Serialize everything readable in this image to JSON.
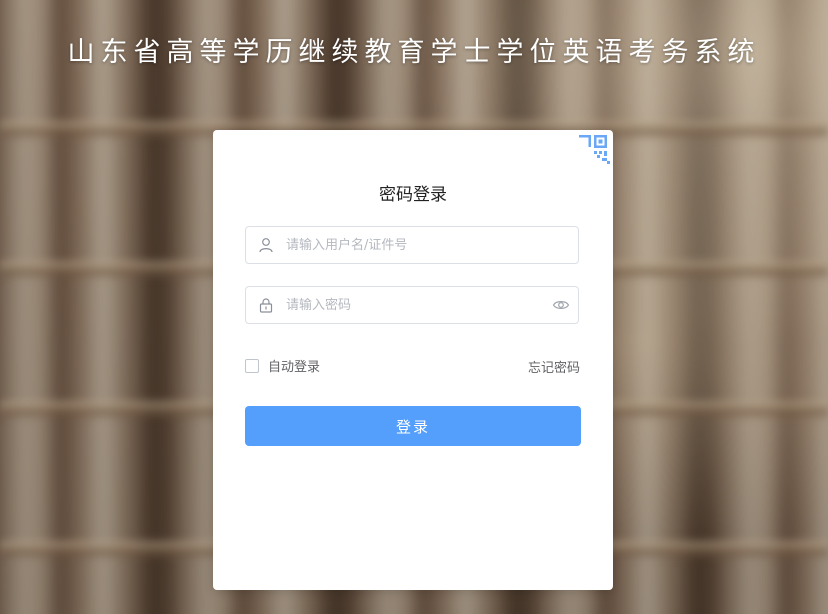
{
  "header": {
    "title": "山东省高等学历继续教育学士学位英语考务系统"
  },
  "login": {
    "title": "密码登录",
    "username_placeholder": "请输入用户名/证件号",
    "username_value": "",
    "password_placeholder": "请输入密码",
    "password_value": "",
    "remember_label": "自动登录",
    "remember_checked": false,
    "forgot_label": "忘记密码",
    "submit_label": "登录"
  },
  "icons": {
    "qr": "qr-code-icon",
    "user": "user-icon",
    "lock": "lock-icon",
    "eye": "eye-icon"
  },
  "colors": {
    "primary": "#549ffc",
    "qr_accent": "#6aa7f5",
    "field_border": "#dcdfe6",
    "placeholder": "#b4b8bf"
  }
}
